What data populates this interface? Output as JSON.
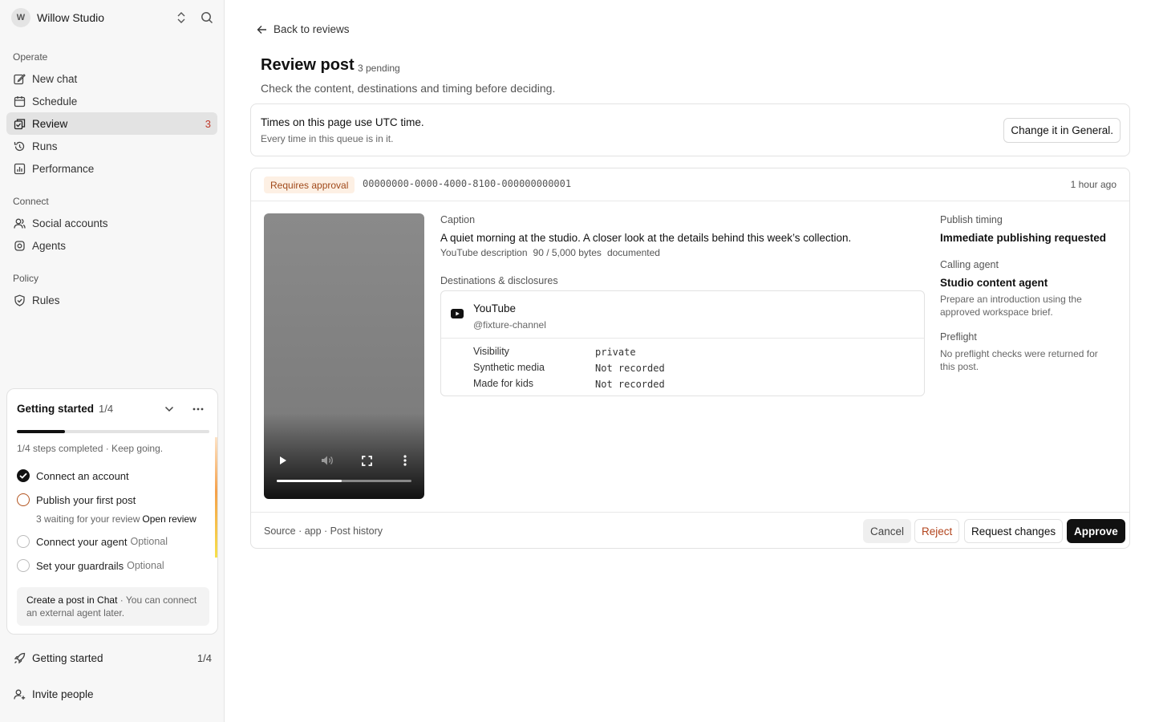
{
  "workspace": {
    "avatar_letter": "W",
    "name": "Willow Studio"
  },
  "sidebar": {
    "sections": [
      {
        "label": "Operate"
      },
      {
        "label": "Connect"
      },
      {
        "label": "Policy"
      }
    ],
    "items": [
      {
        "label": "New chat",
        "icon": "edit-icon"
      },
      {
        "label": "Schedule",
        "icon": "calendar-icon"
      },
      {
        "label": "Review",
        "icon": "review-icon",
        "badge": "3",
        "active": true
      },
      {
        "label": "Runs",
        "icon": "history-icon"
      },
      {
        "label": "Performance",
        "icon": "chart-icon"
      },
      {
        "label": "Social accounts",
        "icon": "users-icon"
      },
      {
        "label": "Agents",
        "icon": "agent-icon"
      },
      {
        "label": "Rules",
        "icon": "shield-icon"
      }
    ]
  },
  "getting_started": {
    "title": "Getting started",
    "count": "1/4",
    "progress": 0.25,
    "note": "1/4 steps completed · Keep going.",
    "steps": [
      {
        "label": "Connect an account",
        "state": "done",
        "optional": ""
      },
      {
        "label": "Publish your first post",
        "state": "current",
        "optional": ""
      },
      {
        "label": "Connect your agent",
        "state": "todo",
        "optional": "Optional"
      },
      {
        "label": "Set your guardrails",
        "state": "todo",
        "optional": "Optional"
      }
    ],
    "step_sub": {
      "text": "3 waiting for your review",
      "link": "Open review"
    },
    "tip": {
      "bold": "Create a post in Chat",
      "text": "· You can connect an external agent later."
    }
  },
  "bottom": {
    "getting_started_label": "Getting started",
    "getting_started_count": "1/4",
    "invite_label": "Invite people"
  },
  "main": {
    "back_label": "Back to reviews",
    "title": "Review post",
    "pending": "3 pending",
    "subtitle": "Check the content, destinations and timing before deciding.",
    "timezone": {
      "title": "Times on this page use UTC time.",
      "sub": "Every time in this queue is in it.",
      "button": "Change it in General."
    },
    "post": {
      "status_badge": "Requires approval",
      "id": "00000000-0000-4000-8100-000000000001",
      "age": "1 hour ago",
      "video_progress": 0.48,
      "caption_label": "Caption",
      "caption": "A quiet morning at the studio. A closer look at the details behind this week’s collection.",
      "desc_meta": [
        "YouTube description",
        "90 / 5,000 bytes",
        "documented"
      ],
      "destinations_label": "Destinations & disclosures",
      "destination": {
        "name": "YouTube",
        "handle": "@fixture-channel",
        "fields": [
          {
            "key": "Visibility",
            "value": "private"
          },
          {
            "key": "Synthetic media",
            "value": "Not recorded"
          },
          {
            "key": "Made for kids",
            "value": "Not recorded"
          }
        ]
      },
      "publish_timing_label": "Publish timing",
      "publish_timing": "Immediate publishing requested",
      "calling_agent_label": "Calling agent",
      "calling_agent": "Studio content agent",
      "calling_agent_desc": "Prepare an introduction using the approved workspace brief.",
      "preflight_label": "Preflight",
      "preflight_text": "No preflight checks were returned for this post.",
      "source": "Source · app · Post history",
      "actions": {
        "cancel": "Cancel",
        "reject": "Reject",
        "request_changes": "Request changes",
        "approve": "Approve"
      }
    }
  },
  "colors": {
    "accent_warning": "#b3451e",
    "badge_bg": "#fdf0e4",
    "primary": "#111111"
  }
}
